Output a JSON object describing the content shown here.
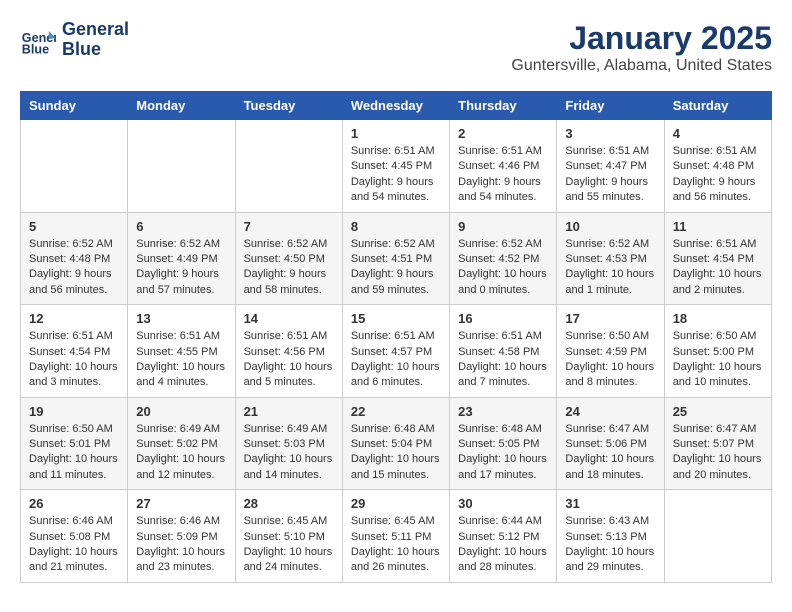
{
  "header": {
    "logo_line1": "General",
    "logo_line2": "Blue",
    "title": "January 2025",
    "subtitle": "Guntersville, Alabama, United States"
  },
  "calendar": {
    "days_of_week": [
      "Sunday",
      "Monday",
      "Tuesday",
      "Wednesday",
      "Thursday",
      "Friday",
      "Saturday"
    ],
    "weeks": [
      [
        {
          "day": "",
          "content": ""
        },
        {
          "day": "",
          "content": ""
        },
        {
          "day": "",
          "content": ""
        },
        {
          "day": "1",
          "content": "Sunrise: 6:51 AM\nSunset: 4:45 PM\nDaylight: 9 hours\nand 54 minutes."
        },
        {
          "day": "2",
          "content": "Sunrise: 6:51 AM\nSunset: 4:46 PM\nDaylight: 9 hours\nand 54 minutes."
        },
        {
          "day": "3",
          "content": "Sunrise: 6:51 AM\nSunset: 4:47 PM\nDaylight: 9 hours\nand 55 minutes."
        },
        {
          "day": "4",
          "content": "Sunrise: 6:51 AM\nSunset: 4:48 PM\nDaylight: 9 hours\nand 56 minutes."
        }
      ],
      [
        {
          "day": "5",
          "content": "Sunrise: 6:52 AM\nSunset: 4:48 PM\nDaylight: 9 hours\nand 56 minutes."
        },
        {
          "day": "6",
          "content": "Sunrise: 6:52 AM\nSunset: 4:49 PM\nDaylight: 9 hours\nand 57 minutes."
        },
        {
          "day": "7",
          "content": "Sunrise: 6:52 AM\nSunset: 4:50 PM\nDaylight: 9 hours\nand 58 minutes."
        },
        {
          "day": "8",
          "content": "Sunrise: 6:52 AM\nSunset: 4:51 PM\nDaylight: 9 hours\nand 59 minutes."
        },
        {
          "day": "9",
          "content": "Sunrise: 6:52 AM\nSunset: 4:52 PM\nDaylight: 10 hours\nand 0 minutes."
        },
        {
          "day": "10",
          "content": "Sunrise: 6:52 AM\nSunset: 4:53 PM\nDaylight: 10 hours\nand 1 minute."
        },
        {
          "day": "11",
          "content": "Sunrise: 6:51 AM\nSunset: 4:54 PM\nDaylight: 10 hours\nand 2 minutes."
        }
      ],
      [
        {
          "day": "12",
          "content": "Sunrise: 6:51 AM\nSunset: 4:54 PM\nDaylight: 10 hours\nand 3 minutes."
        },
        {
          "day": "13",
          "content": "Sunrise: 6:51 AM\nSunset: 4:55 PM\nDaylight: 10 hours\nand 4 minutes."
        },
        {
          "day": "14",
          "content": "Sunrise: 6:51 AM\nSunset: 4:56 PM\nDaylight: 10 hours\nand 5 minutes."
        },
        {
          "day": "15",
          "content": "Sunrise: 6:51 AM\nSunset: 4:57 PM\nDaylight: 10 hours\nand 6 minutes."
        },
        {
          "day": "16",
          "content": "Sunrise: 6:51 AM\nSunset: 4:58 PM\nDaylight: 10 hours\nand 7 minutes."
        },
        {
          "day": "17",
          "content": "Sunrise: 6:50 AM\nSunset: 4:59 PM\nDaylight: 10 hours\nand 8 minutes."
        },
        {
          "day": "18",
          "content": "Sunrise: 6:50 AM\nSunset: 5:00 PM\nDaylight: 10 hours\nand 10 minutes."
        }
      ],
      [
        {
          "day": "19",
          "content": "Sunrise: 6:50 AM\nSunset: 5:01 PM\nDaylight: 10 hours\nand 11 minutes."
        },
        {
          "day": "20",
          "content": "Sunrise: 6:49 AM\nSunset: 5:02 PM\nDaylight: 10 hours\nand 12 minutes."
        },
        {
          "day": "21",
          "content": "Sunrise: 6:49 AM\nSunset: 5:03 PM\nDaylight: 10 hours\nand 14 minutes."
        },
        {
          "day": "22",
          "content": "Sunrise: 6:48 AM\nSunset: 5:04 PM\nDaylight: 10 hours\nand 15 minutes."
        },
        {
          "day": "23",
          "content": "Sunrise: 6:48 AM\nSunset: 5:05 PM\nDaylight: 10 hours\nand 17 minutes."
        },
        {
          "day": "24",
          "content": "Sunrise: 6:47 AM\nSunset: 5:06 PM\nDaylight: 10 hours\nand 18 minutes."
        },
        {
          "day": "25",
          "content": "Sunrise: 6:47 AM\nSunset: 5:07 PM\nDaylight: 10 hours\nand 20 minutes."
        }
      ],
      [
        {
          "day": "26",
          "content": "Sunrise: 6:46 AM\nSunset: 5:08 PM\nDaylight: 10 hours\nand 21 minutes."
        },
        {
          "day": "27",
          "content": "Sunrise: 6:46 AM\nSunset: 5:09 PM\nDaylight: 10 hours\nand 23 minutes."
        },
        {
          "day": "28",
          "content": "Sunrise: 6:45 AM\nSunset: 5:10 PM\nDaylight: 10 hours\nand 24 minutes."
        },
        {
          "day": "29",
          "content": "Sunrise: 6:45 AM\nSunset: 5:11 PM\nDaylight: 10 hours\nand 26 minutes."
        },
        {
          "day": "30",
          "content": "Sunrise: 6:44 AM\nSunset: 5:12 PM\nDaylight: 10 hours\nand 28 minutes."
        },
        {
          "day": "31",
          "content": "Sunrise: 6:43 AM\nSunset: 5:13 PM\nDaylight: 10 hours\nand 29 minutes."
        },
        {
          "day": "",
          "content": ""
        }
      ]
    ]
  }
}
